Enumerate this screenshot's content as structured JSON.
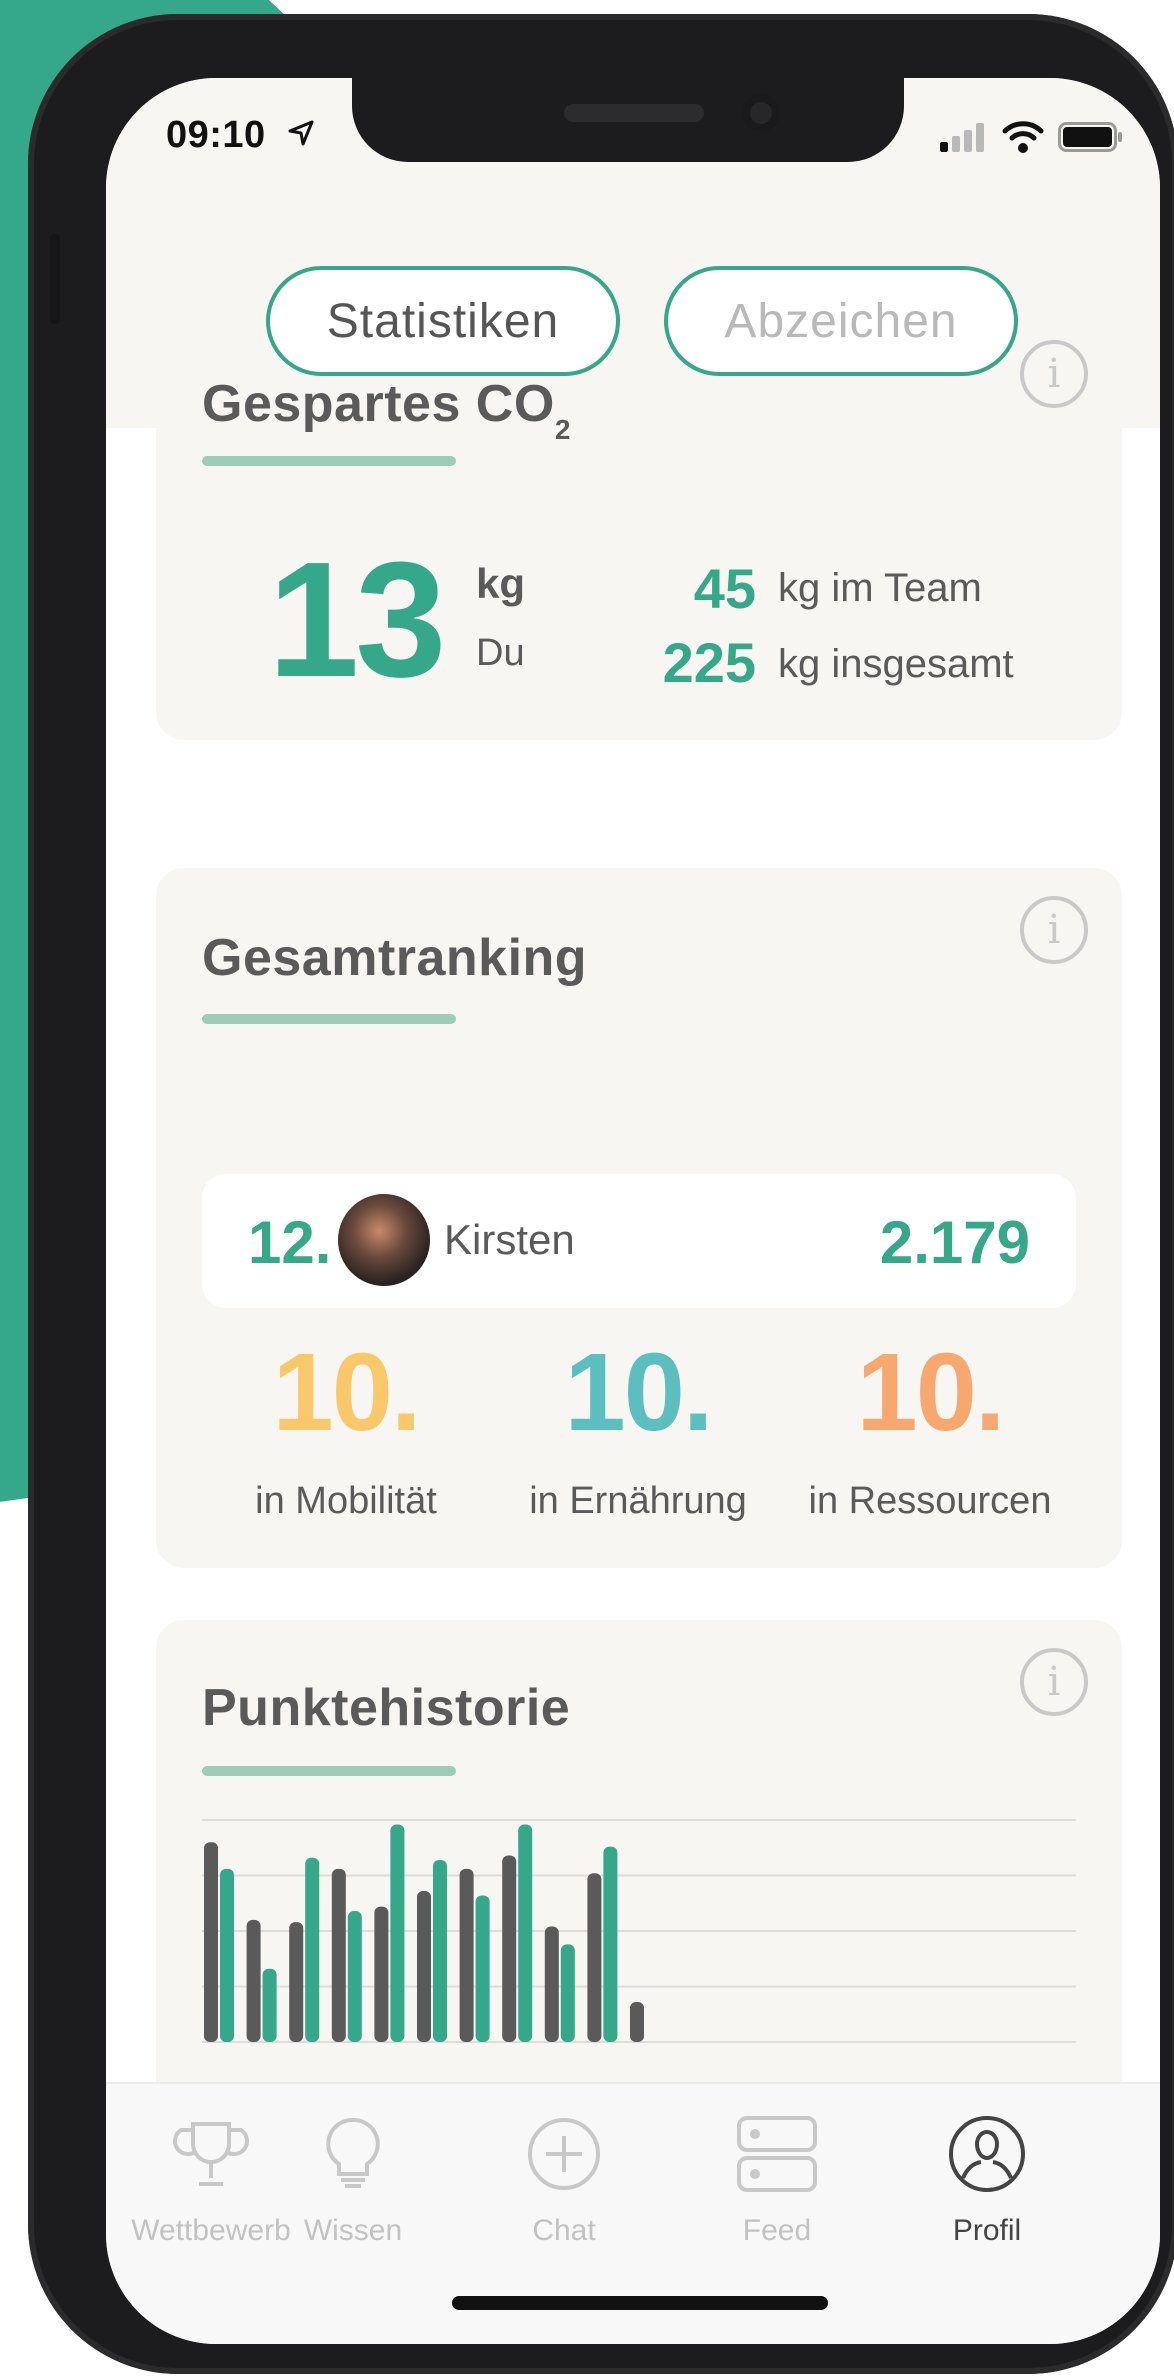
{
  "status_bar": {
    "time": "09:10"
  },
  "segments": {
    "statistics_label": "Statistiken",
    "badges_label": "Abzeichen"
  },
  "co2_card": {
    "title_main": "Gespartes CO",
    "title_sub": "2",
    "personal_value": "13",
    "personal_unit": "kg",
    "personal_label": "Du",
    "team_value": "45",
    "team_label": "kg im Team",
    "total_value": "225",
    "total_label": "kg insgesamt"
  },
  "ranking_card": {
    "title": "Gesamtranking",
    "position": "12.",
    "user_name": "Kirsten",
    "points": "2.179",
    "categories": [
      {
        "rank": "10.",
        "label": "in Mobilität",
        "color": "#f9c86a"
      },
      {
        "rank": "10.",
        "label": "in Ernährung",
        "color": "#5bbfbf"
      },
      {
        "rank": "10.",
        "label": "in Ressourcen",
        "color": "#f6a86e"
      }
    ]
  },
  "history_card": {
    "title": "Punktehistorie"
  },
  "chart_data": {
    "type": "bar",
    "title": "Punktehistorie",
    "series": [
      {
        "name": "",
        "color": "#5a5a5a",
        "values": [
          90,
          55,
          54,
          78,
          61,
          68,
          78,
          84,
          52,
          76,
          18
        ]
      },
      {
        "name": "",
        "color": "#35a88a",
        "values": [
          78,
          33,
          83,
          59,
          98,
          82,
          66,
          98,
          44,
          88,
          0
        ]
      }
    ],
    "grid": true,
    "ylim": [
      0,
      100
    ]
  },
  "tabbar": {
    "items": [
      {
        "label": "Wettbewerb",
        "icon": "trophy-icon",
        "active": false
      },
      {
        "label": "Wissen",
        "icon": "lightbulb-icon",
        "active": false
      },
      {
        "label": "Chat",
        "icon": "plus-circle-icon",
        "active": false
      },
      {
        "label": "Feed",
        "icon": "feed-icon",
        "active": false
      },
      {
        "label": "Profil",
        "icon": "profile-icon",
        "active": true
      }
    ]
  },
  "colors": {
    "brand": "#35a88a",
    "underline": "#9ccdb7",
    "card_bg": "#f8f6f3",
    "inactive": "#c2c2c2"
  }
}
